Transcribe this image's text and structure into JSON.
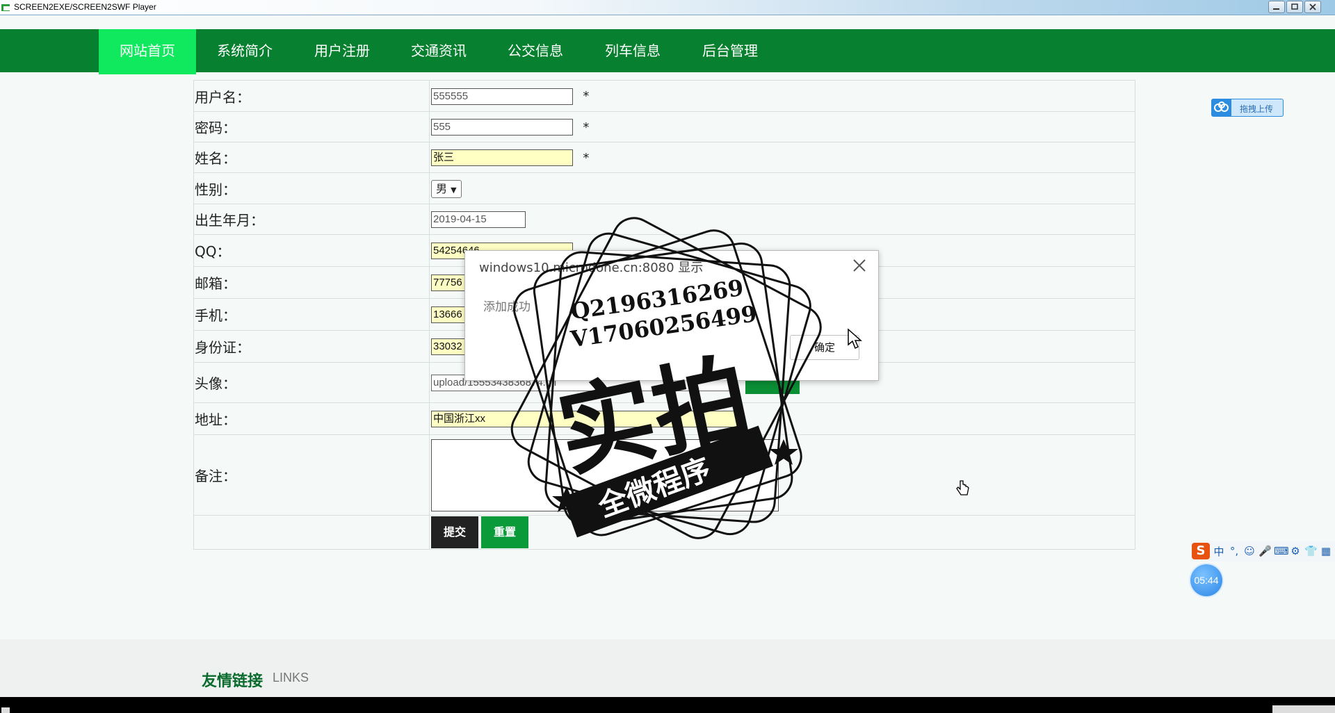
{
  "player": {
    "title": "SCREEN2EXE/SCREEN2SWF Player"
  },
  "nav": {
    "items": [
      "网站首页",
      "系统简介",
      "用户注册",
      "交通资讯",
      "公交信息",
      "列车信息",
      "后台管理"
    ],
    "active_index": 0
  },
  "form": {
    "username_label": "用户名：",
    "username_value": "555555",
    "password_label": "密码：",
    "password_value": "555",
    "name_label": "姓名：",
    "name_value": "张三",
    "gender_label": "性别：",
    "gender_value": "男",
    "birth_label": "出生年月：",
    "birth_value": "2019-04-15",
    "qq_label": "QQ：",
    "qq_value": "54254646",
    "email_label": "邮箱：",
    "email_value": "77756",
    "phone_label": "手机：",
    "phone_value": "13666",
    "idcard_label": "身份证：",
    "idcard_value": "33032",
    "avatar_label": "头像：",
    "avatar_value": "upload/1555343836874.gif",
    "address_label": "地址：",
    "address_value": "中国浙江xx",
    "remark_label": "备注：",
    "required_mark": "*",
    "submit_label": "提交",
    "reset_label": "重置"
  },
  "footer": {
    "links_title": "友情链接",
    "links_sub": "LINKS"
  },
  "widgets": {
    "upload_text": "拖拽上传",
    "timer": "05:44",
    "ime_items": [
      "中",
      "°,",
      "☺",
      "🎤",
      "⌨",
      "⚙",
      "👕",
      "▦"
    ],
    "ime_logo": "S"
  },
  "dialog": {
    "title": "windows10.microdone.cn:8080 显示",
    "message": "添加成功",
    "ok_label": "确定"
  },
  "watermark": {
    "line1": "Q2196316269",
    "line2": "V17060256499",
    "big": "实拍",
    "banner": "全微程序"
  },
  "colors": {
    "nav_bg": "#07802f",
    "nav_active": "#10e85e",
    "field_highlight": "#ffffc4"
  }
}
